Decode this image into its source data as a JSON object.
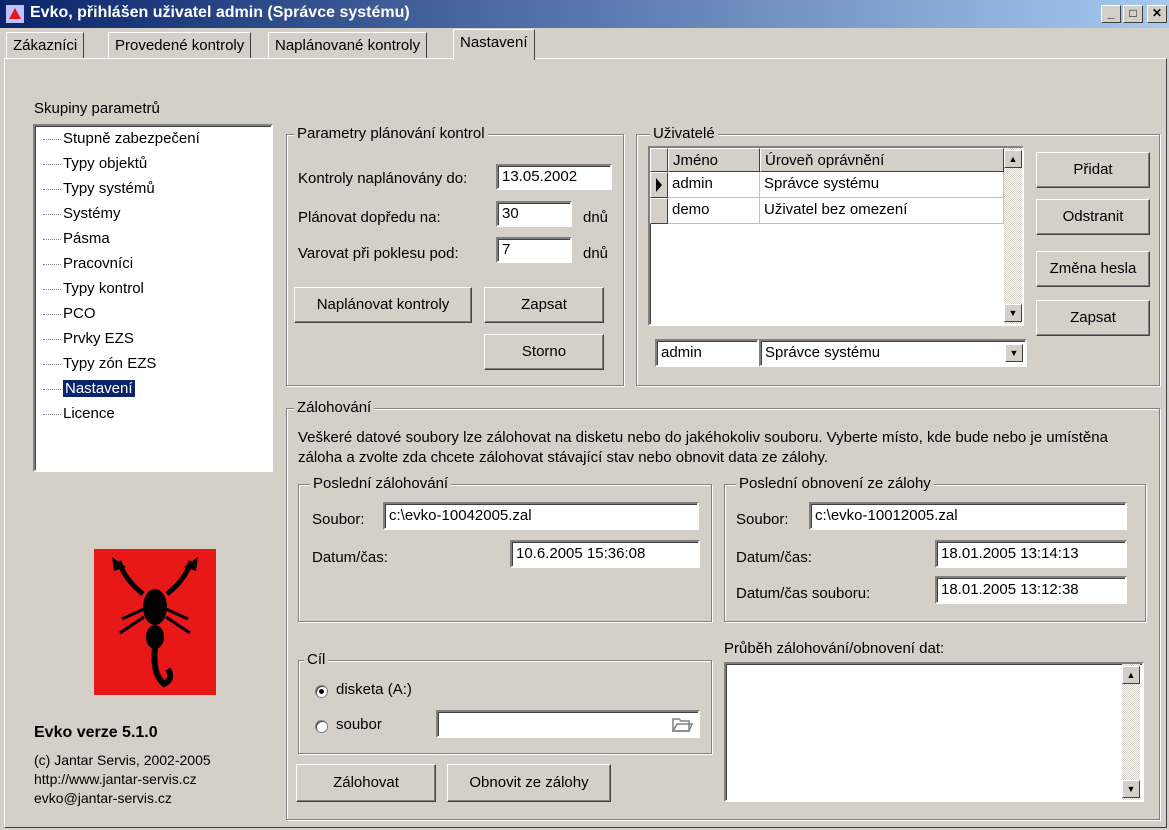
{
  "window": {
    "title": "Evko, přihlášen uživatel admin (Správce systému)",
    "minimize": "_",
    "maximize": "□",
    "close": "✕"
  },
  "tabs": [
    {
      "label": "Zákazníci"
    },
    {
      "label": "Provedené kontroly"
    },
    {
      "label": "Naplánované kontroly"
    },
    {
      "label": "Nastavení",
      "active": true
    }
  ],
  "sidebar": {
    "title": "Skupiny parametrů",
    "items": [
      "Stupně zabezpečení",
      "Typy objektů",
      "Typy systémů",
      "Systémy",
      "Pásma",
      "Pracovníci",
      "Typy kontrol",
      "PCO",
      "Prvky EZS",
      "Typy zón EZS",
      "Nastavení",
      "Licence"
    ],
    "selected": "Nastavení"
  },
  "about": {
    "version": "Evko verze 5.1.0",
    "copyright": "(c) Jantar Servis, 2002-2005",
    "web": "http://www.jantar-servis.cz",
    "email": "evko@jantar-servis.cz",
    "logo_color": "#e81818"
  },
  "planning": {
    "title": "Parametry plánování kontrol",
    "planned_to_label": "Kontroly naplánovány do:",
    "planned_to_value": "13.05.2002",
    "ahead_label": "Plánovat dopředu na:",
    "ahead_value": "30",
    "ahead_unit": "dnů",
    "warn_label": "Varovat při poklesu pod:",
    "warn_value": "7",
    "warn_unit": "dnů",
    "plan_button": "Naplánovat kontroly",
    "save_button": "Zapsat",
    "cancel_button": "Storno"
  },
  "users": {
    "title": "Uživatelé",
    "columns": [
      "Jméno",
      "Úroveň oprávnění"
    ],
    "rows": [
      {
        "name": "admin",
        "level": "Správce systému"
      },
      {
        "name": "demo",
        "level": "Uživatel bez omezení"
      }
    ],
    "edit_name": "admin",
    "edit_level": "Správce systému",
    "add_button": "Přidat",
    "remove_button": "Odstranit",
    "password_button": "Změna hesla",
    "save_button": "Zapsat"
  },
  "backup": {
    "title": "Zálohování",
    "description": "Veškeré datové soubory lze zálohovat na disketu nebo do jakéhokoliv souboru. Vyberte místo, kde bude nebo je umístěna záloha a zvolte zda chcete zálohovat stávající stav nebo obnovit data ze zálohy.",
    "last_backup": {
      "title": "Poslední zálohování",
      "file_label": "Soubor:",
      "file_value": "c:\\evko-10042005.zal",
      "datetime_label": "Datum/čas:",
      "datetime_value": "10.6.2005 15:36:08"
    },
    "last_restore": {
      "title": "Poslední obnovení ze zálohy",
      "file_label": "Soubor:",
      "file_value": "c:\\evko-10012005.zal",
      "datetime_label": "Datum/čas:",
      "datetime_value": "18.01.2005 13:14:13",
      "filetime_label": "Datum/čas souboru:",
      "filetime_value": "18.01.2005 13:12:38"
    },
    "target": {
      "title": "Cíl",
      "floppy_label": "disketa (A:)",
      "file_label": "soubor",
      "file_value": "",
      "selected": "floppy"
    },
    "progress_label": "Průběh zálohování/obnovení dat:",
    "backup_button": "Zálohovat",
    "restore_button": "Obnovit ze zálohy"
  }
}
